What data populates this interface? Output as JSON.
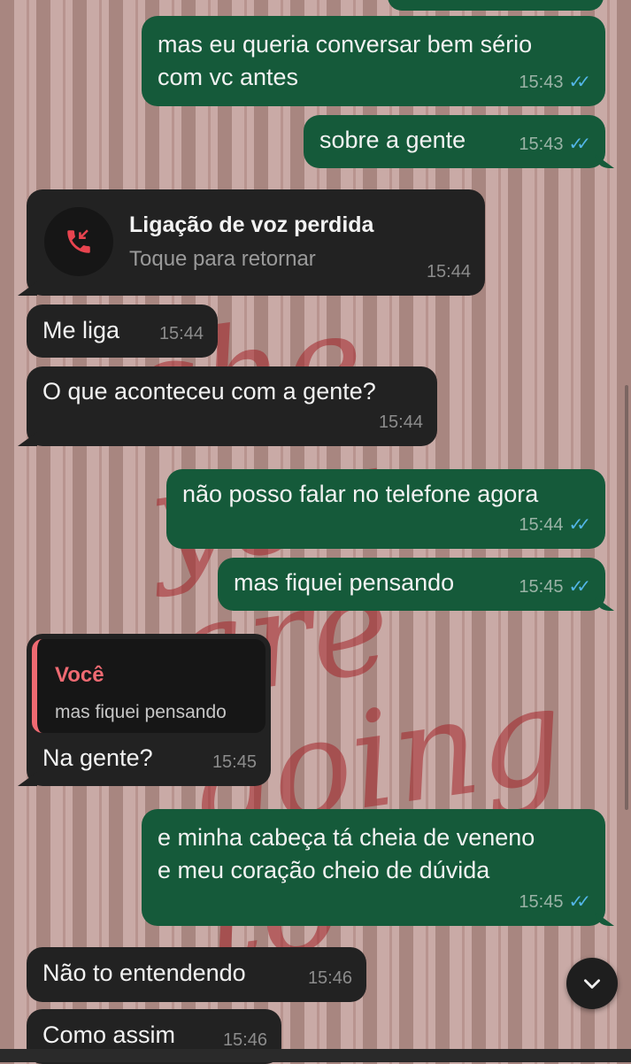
{
  "wallpaper": {
    "lines": [
      "she",
      "you are",
      "going",
      "to"
    ]
  },
  "messages": [
    {
      "dir": "out",
      "text": "mas eu queria conversar bem sério\ncom vc antes",
      "time": "15:43",
      "status": "read"
    },
    {
      "dir": "out",
      "text": "sobre a gente",
      "time": "15:43",
      "status": "read"
    },
    {
      "dir": "call",
      "title": "Ligação de voz perdida",
      "subtitle": "Toque para retornar",
      "time": "15:44"
    },
    {
      "dir": "in",
      "text": "Me liga",
      "time": "15:44"
    },
    {
      "dir": "in",
      "text": "O que aconteceu com a gente?",
      "time": "15:44"
    },
    {
      "dir": "out",
      "text": "não posso falar no telefone agora",
      "time": "15:44",
      "status": "read"
    },
    {
      "dir": "out",
      "text": "mas fiquei pensando",
      "time": "15:45",
      "status": "read"
    },
    {
      "dir": "in",
      "quote": {
        "author": "Você",
        "text": "mas fiquei pensando"
      },
      "text": "Na gente?",
      "time": "15:45"
    },
    {
      "dir": "out",
      "text": "e minha cabeça tá cheia de veneno\ne meu coração cheio de dúvida",
      "time": "15:45",
      "status": "read"
    },
    {
      "dir": "in",
      "text": "Não to entendendo",
      "time": "15:46"
    },
    {
      "dir": "in",
      "text": "Como assim",
      "time": "15:46"
    }
  ],
  "icons": {
    "ticks": "double-check-icon",
    "missed_call": "missed-call-icon",
    "scroll_down": "chevron-down-icon"
  },
  "colors": {
    "outgoing_bubble": "#155a3a",
    "incoming_bubble": "#222222",
    "read_ticks": "#53b6e8",
    "missed_call": "#e8444f",
    "quote_accent": "#ef6a72"
  }
}
